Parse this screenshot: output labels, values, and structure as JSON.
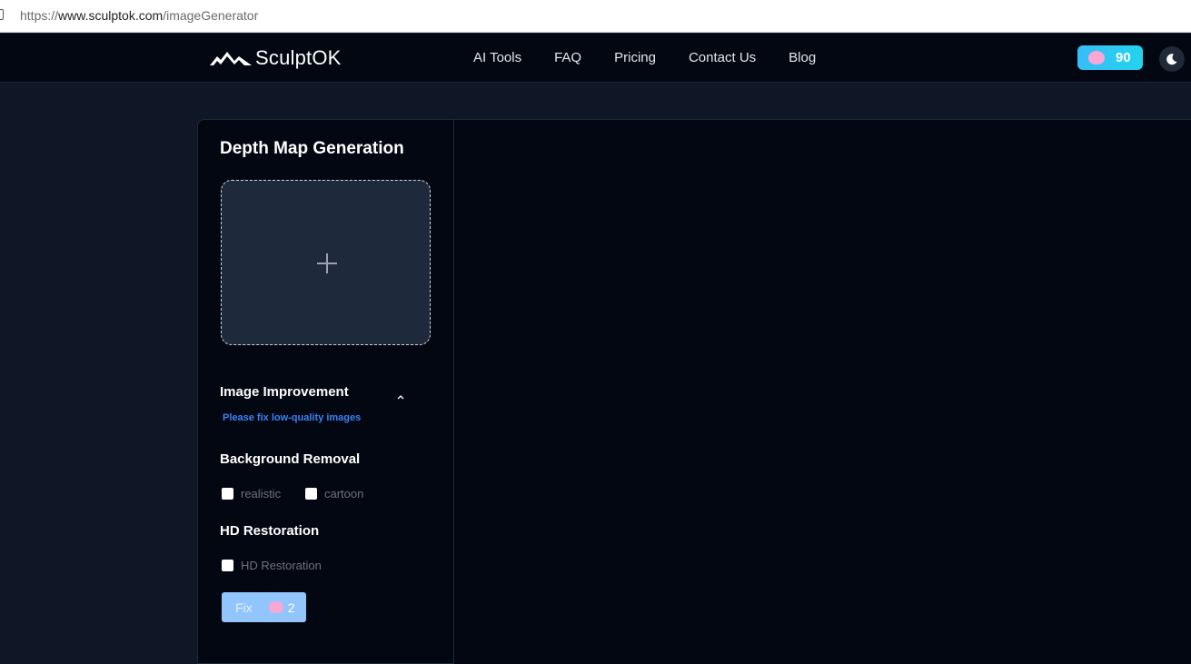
{
  "browser": {
    "url_scheme": "https://",
    "url_host": "www.sculptok.com",
    "url_path": "/imageGenerator"
  },
  "header": {
    "logo_text": "SculptOK",
    "nav": [
      "AI Tools",
      "FAQ",
      "Pricing",
      "Contact Us",
      "Blog"
    ],
    "credits": "90",
    "credits_icon": "piggy-bank-icon",
    "theme_icon": "moon-icon"
  },
  "panel": {
    "title": "Depth Map Generation",
    "upload_icon": "plus-icon",
    "improvement": {
      "title": "Image Improvement",
      "hint": "Please fix low-quality images"
    },
    "background_removal": {
      "title": "Background Removal",
      "options": [
        "realistic",
        "cartoon"
      ]
    },
    "hd_restoration": {
      "title": "HD Restoration",
      "option": "HD Restoration"
    },
    "fix_button": {
      "label": "Fix",
      "cost": "2"
    }
  },
  "colors": {
    "nav_bg": "#030712",
    "page_bg": "#0f1626",
    "accent": "#3b82f6",
    "credits_bg": "#38bdf8",
    "fix_bg": "#93c5fd"
  }
}
